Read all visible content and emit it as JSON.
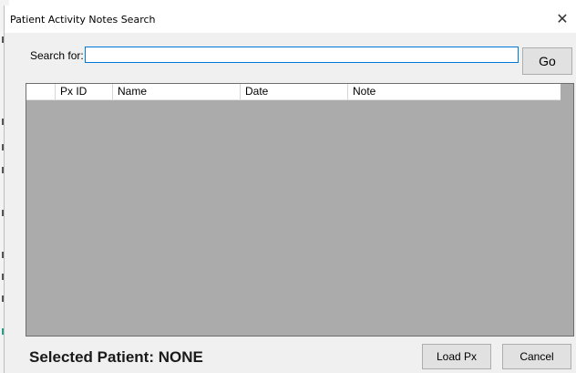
{
  "window": {
    "title": "Patient Activity Notes Search",
    "close_glyph": "✕"
  },
  "search": {
    "label": "Search for:",
    "value": "",
    "placeholder": "",
    "go_label": "Go"
  },
  "grid": {
    "columns": [
      "",
      "Px ID",
      "Name",
      "Date",
      "Note"
    ],
    "rows": [],
    "body_color": "#ababab"
  },
  "footer": {
    "selected_patient": "Selected Patient: NONE",
    "load_label": "Load Px",
    "cancel_label": "Cancel"
  },
  "colors": {
    "focus_border": "#0078d7",
    "button_face": "#e1e1e1",
    "dialog_bg": "#f0f0f0"
  }
}
